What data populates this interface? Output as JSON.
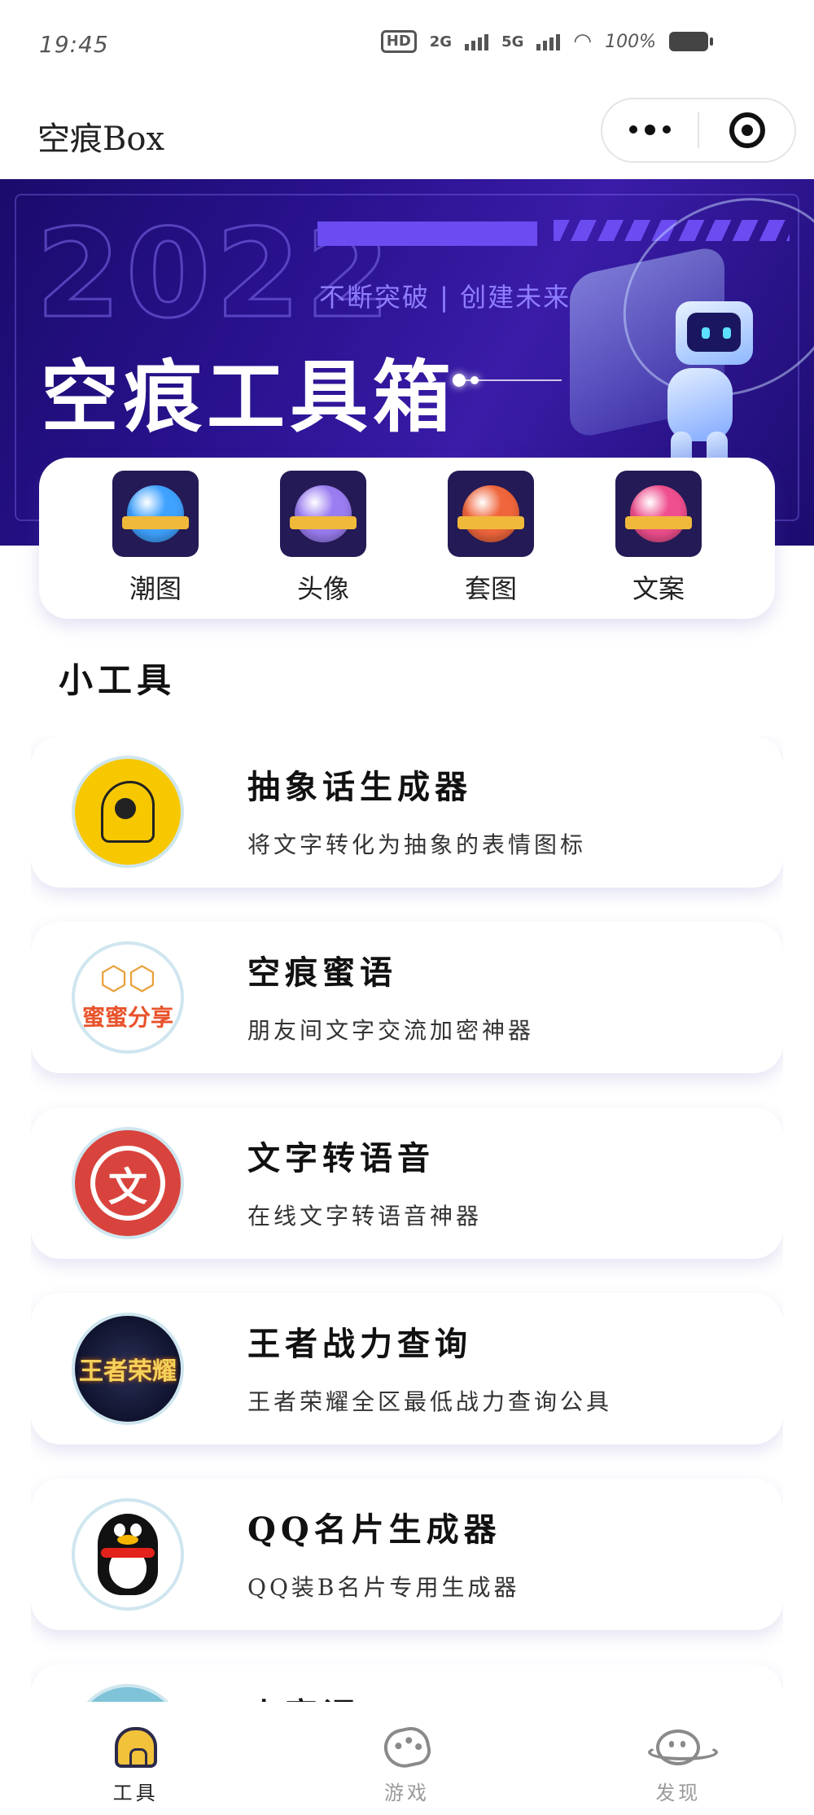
{
  "status_bar": {
    "time": "19:45",
    "hd": "HD",
    "network_1": "2G",
    "network_2": "5G",
    "battery": "100%"
  },
  "nav": {
    "title": "空痕Box"
  },
  "banner": {
    "year": "2022",
    "slogan": "不断突破 | 创建未来",
    "title": "空痕工具箱"
  },
  "categories": [
    {
      "label": "潮图",
      "color": "#3fa2ff"
    },
    {
      "label": "头像",
      "color": "#9b7df2"
    },
    {
      "label": "套图",
      "color": "#f0663c"
    },
    {
      "label": "文案",
      "color": "#ef4f8e"
    }
  ],
  "section_title": "小工具",
  "tools": [
    {
      "name": "抽象话生成器",
      "desc": "将文字转化为抽象的表情图标",
      "icon": "abstract-head-icon"
    },
    {
      "name": "空痕蜜语",
      "desc": "朋友间文字交流加密神器",
      "icon": "honey-share-icon",
      "icon_text": "蜜蜜分享"
    },
    {
      "name": "文字转语音",
      "desc": "在线文字转语音神器",
      "icon": "text-bubble-icon",
      "icon_text": "文"
    },
    {
      "name": "王者战力查询",
      "desc": "王者荣耀全区最低战力查询公具",
      "icon": "king-glory-icon",
      "icon_text": "王者荣耀"
    },
    {
      "name": "QQ名片生成器",
      "desc": "QQ装B名片专用生成器",
      "icon": "qq-penguin-icon"
    },
    {
      "name": "小密调",
      "desc": "",
      "icon": "partial-icon"
    }
  ],
  "tabbar": [
    {
      "label": "工具",
      "active": true,
      "icon": "home-icon"
    },
    {
      "label": "游戏",
      "active": false,
      "icon": "game-icon"
    },
    {
      "label": "发现",
      "active": false,
      "icon": "planet-icon"
    }
  ]
}
